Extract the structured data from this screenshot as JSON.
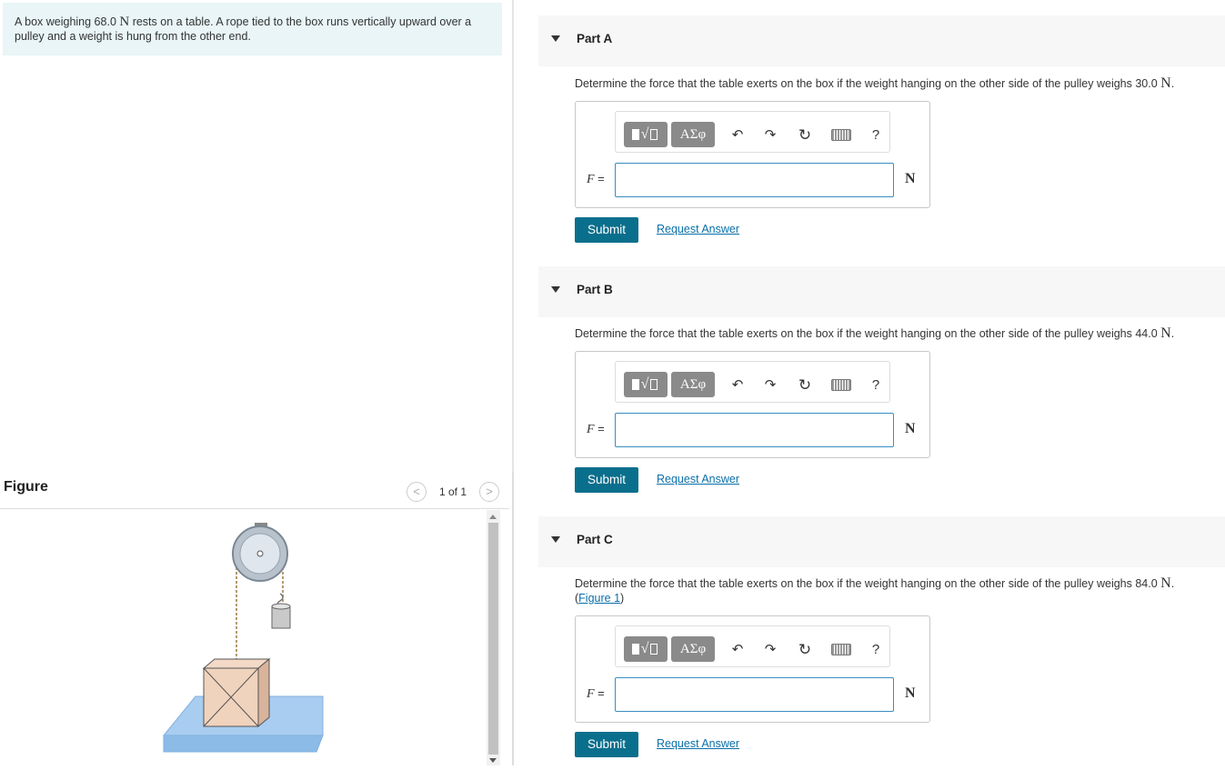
{
  "problem": {
    "text_before": "A box weighing 68.0 ",
    "unit": "N",
    "text_after": " rests on a table. A rope tied to the box runs vertically upward over a pulley and a weight is hung from the other end."
  },
  "figure": {
    "title": "Figure",
    "prev_icon": "chevron-left-icon",
    "next_icon": "chevron-right-icon",
    "prev_glyph": "<",
    "next_glyph": ">",
    "pager": "1 of 1"
  },
  "toolbar": {
    "templates_label": "√",
    "symbols_label": "ΑΣφ",
    "undo_glyph": "↶",
    "redo_glyph": "↷",
    "reset_glyph": "↻",
    "help_glyph": "?"
  },
  "parts": [
    {
      "title": "Part A",
      "question": "Determine the force that the table exerts on the box if the weight hanging on the other side of the pulley weighs 30.0 ",
      "question_unit": "N",
      "question_end": ".",
      "var_label": "F",
      "equals": " =",
      "input_value": "",
      "answer_unit": "N",
      "submit_label": "Submit",
      "request_label": "Request Answer"
    },
    {
      "title": "Part B",
      "question": "Determine the force that the table exerts on the box if the weight hanging on the other side of the pulley weighs 44.0 ",
      "question_unit": "N",
      "question_end": ".",
      "var_label": "F",
      "equals": " =",
      "input_value": "",
      "answer_unit": "N",
      "submit_label": "Submit",
      "request_label": "Request Answer"
    },
    {
      "title": "Part C",
      "question": "Determine the force that the table exerts on the box if the weight hanging on the other side of the pulley weighs 84.0 ",
      "question_unit": "N",
      "question_end": ".",
      "figure_link": "Figure 1",
      "var_label": "F",
      "equals": " =",
      "input_value": "",
      "answer_unit": "N",
      "submit_label": "Submit",
      "request_label": "Request Answer"
    }
  ]
}
